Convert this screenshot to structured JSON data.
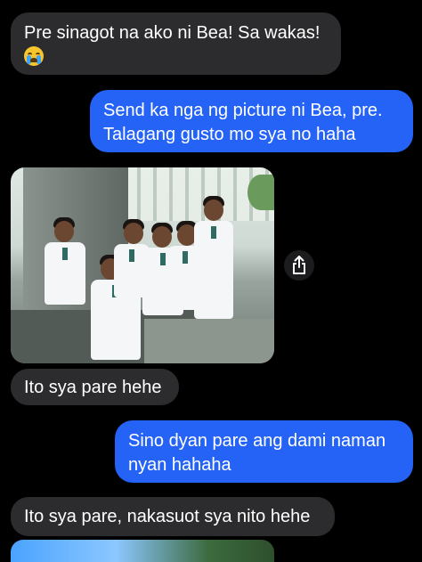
{
  "messages": [
    {
      "id": "m1",
      "direction": "received",
      "text": "Pre sinagot na ako ni Bea! Sa wakas!",
      "emoji": "loudly-crying-face"
    },
    {
      "id": "m2",
      "direction": "sent",
      "text": "Send ka nga ng picture ni Bea, pre.\nTalagang gusto mo sya no haha"
    },
    {
      "id": "m3",
      "direction": "received",
      "type": "photo",
      "description_icon": "share-icon"
    },
    {
      "id": "m4",
      "direction": "received",
      "text": "Ito sya pare hehe"
    },
    {
      "id": "m5",
      "direction": "sent",
      "text": "Sino dyan pare ang dami naman\nnyan hahaha"
    },
    {
      "id": "m6",
      "direction": "received",
      "text": "Ito sya pare, nakasuot sya nito hehe"
    },
    {
      "id": "m7",
      "direction": "received",
      "type": "photo"
    }
  ],
  "colors": {
    "background": "#000000",
    "received_bubble": "#2c2c2e",
    "sent_bubble": "#2563f6",
    "text": "#ffffff"
  }
}
